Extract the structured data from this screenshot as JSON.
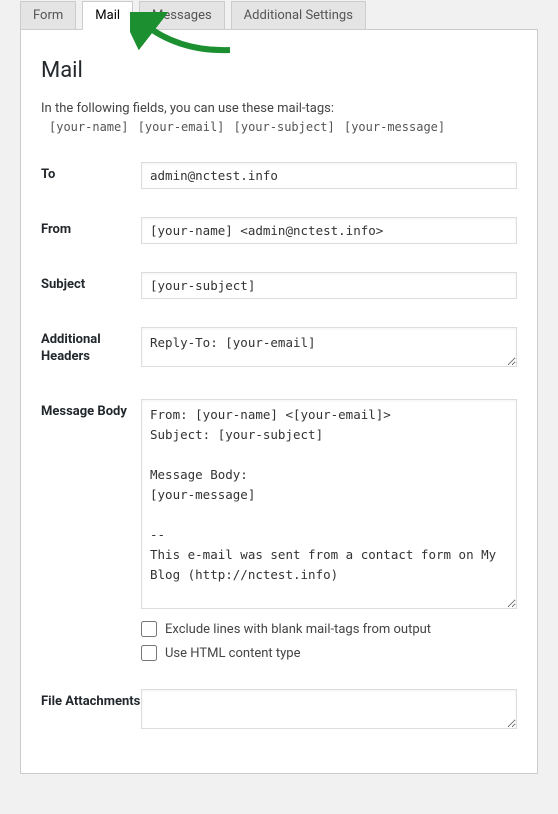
{
  "tabs": [
    {
      "label": "Form",
      "active": false
    },
    {
      "label": "Mail",
      "active": true
    },
    {
      "label": "Messages",
      "active": false
    },
    {
      "label": "Additional Settings",
      "active": false
    }
  ],
  "section": {
    "title": "Mail",
    "hint": "In the following fields, you can use these mail-tags:",
    "mail_tags": "[your-name] [your-email] [your-subject] [your-message]"
  },
  "fields": {
    "to": {
      "label": "To",
      "value": "admin@nctest.info"
    },
    "from": {
      "label": "From",
      "value": "[your-name] <admin@nctest.info>"
    },
    "subject": {
      "label": "Subject",
      "value": "[your-subject]"
    },
    "headers": {
      "label": "Additional Headers",
      "value": "Reply-To: [your-email]"
    },
    "body": {
      "label": "Message Body",
      "value": "From: [your-name] <[your-email]>\nSubject: [your-subject]\n\nMessage Body:\n[your-message]\n\n--\nThis e-mail was sent from a contact form on My Blog (http://nctest.info)"
    },
    "attachments": {
      "label": "File Attachments",
      "value": ""
    }
  },
  "checkboxes": {
    "exclude_blank": {
      "label": "Exclude lines with blank mail-tags from output",
      "checked": false
    },
    "use_html": {
      "label": "Use HTML content type",
      "checked": false
    }
  }
}
